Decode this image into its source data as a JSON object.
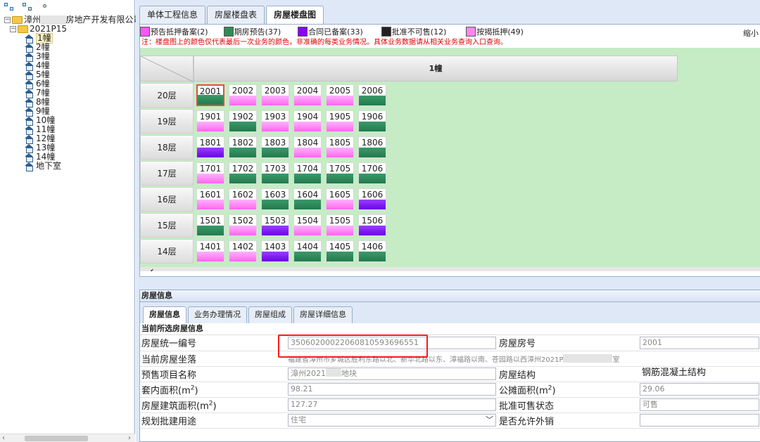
{
  "tree": {
    "company_prefix": "漳州",
    "company_suffix": "房地产开发有限公司",
    "project": "2021P15",
    "buildings": [
      "1幢",
      "2幢",
      "3幢",
      "4幢",
      "5幢",
      "6幢",
      "7幢",
      "8幢",
      "9幢",
      "10幢",
      "11幢",
      "12幢",
      "13幢",
      "14幢",
      "地下室"
    ]
  },
  "top_tabs": [
    "单体工程信息",
    "房屋楼盘表",
    "房屋楼盘图"
  ],
  "legend": [
    {
      "label": "预告抵押备案(2)",
      "color": "#ff55ff"
    },
    {
      "label": "期房预告(37)",
      "color": "#2e8b57"
    },
    {
      "label": "合同已备案(33)",
      "color": "#8b00ff"
    },
    {
      "label": "批准不可售(12)",
      "color": "#222222"
    },
    {
      "label": "按揭抵押(49)",
      "color": "#ff88ee"
    }
  ],
  "shrink_label": "缩小",
  "note": "注：楼盘图上的颜色仅代表最后一次业务的颜色，非准确的每类业务情况。具体业务数据请从相关业务查询入口查询。",
  "building_header": "1幢",
  "floors": [
    {
      "label": "20层",
      "units": [
        [
          "2001",
          "g"
        ],
        [
          "2002",
          "p"
        ],
        [
          "2003",
          "p"
        ],
        [
          "2004",
          "p"
        ],
        [
          "2005",
          "p"
        ],
        [
          "2006",
          "g"
        ]
      ]
    },
    {
      "label": "19层",
      "units": [
        [
          "1901",
          "p"
        ],
        [
          "1902",
          "g"
        ],
        [
          "1903",
          "p"
        ],
        [
          "1904",
          "p"
        ],
        [
          "1905",
          "p"
        ],
        [
          "1906",
          "g"
        ]
      ]
    },
    {
      "label": "18层",
      "units": [
        [
          "1801",
          "v"
        ],
        [
          "1802",
          "g"
        ],
        [
          "1803",
          "g"
        ],
        [
          "1804",
          "p"
        ],
        [
          "1805",
          "p"
        ],
        [
          "1806",
          "g"
        ]
      ]
    },
    {
      "label": "17层",
      "units": [
        [
          "1701",
          "p"
        ],
        [
          "1702",
          "g"
        ],
        [
          "1703",
          "g"
        ],
        [
          "1704",
          "g"
        ],
        [
          "1705",
          "g"
        ],
        [
          "1706",
          "g"
        ]
      ]
    },
    {
      "label": "16层",
      "units": [
        [
          "1601",
          "p"
        ],
        [
          "1602",
          "p"
        ],
        [
          "1603",
          "g"
        ],
        [
          "1604",
          "g"
        ],
        [
          "1605",
          "p"
        ],
        [
          "1606",
          "v"
        ]
      ]
    },
    {
      "label": "15层",
      "units": [
        [
          "1501",
          "g"
        ],
        [
          "1502",
          "p"
        ],
        [
          "1503",
          "v"
        ],
        [
          "1504",
          "p"
        ],
        [
          "1505",
          "p"
        ],
        [
          "1506",
          "v"
        ]
      ]
    },
    {
      "label": "14层",
      "units": [
        [
          "1401",
          "p"
        ],
        [
          "1402",
          "p"
        ],
        [
          "1403",
          "v"
        ],
        [
          "1404",
          "g"
        ],
        [
          "1405",
          "g"
        ],
        [
          "1406",
          "g"
        ]
      ]
    }
  ],
  "info": {
    "title": "房屋信息",
    "tabs": [
      "房屋信息",
      "业务办理情况",
      "房屋组成",
      "房屋详细信息"
    ],
    "section": "当前所选房屋信息",
    "rows": [
      {
        "l1": "房屋统一编号",
        "v1": "35060200022060810593696551",
        "l2": "房屋房号",
        "v2": "2001"
      },
      {
        "l1": "当前房屋坐落",
        "v1": "福建省漳州市芗城区胜利东路以北、新华北路以东、漳福路以南、苍园路以西漳州2021P",
        "v1b": "室",
        "l2": "",
        "v2": ""
      },
      {
        "l1": "预售项目名称",
        "v1": "漳州2021",
        "v1b": "地块",
        "l2": "房屋结构",
        "v2": "钢筋混凝土结构"
      },
      {
        "l1": "套内面积(m",
        "v1": "98.21",
        "l2": "公摊面积(m",
        "v2": "29.06"
      },
      {
        "l1": "房屋建筑面积(m",
        "v1": "127.27",
        "l2": "批准可售状态",
        "v2": "可售"
      },
      {
        "l1": "规划批建用途",
        "v1": "住宅",
        "l2": "是否允许外销",
        "v2": ""
      }
    ],
    "sup": "2",
    "close_paren": ")"
  }
}
